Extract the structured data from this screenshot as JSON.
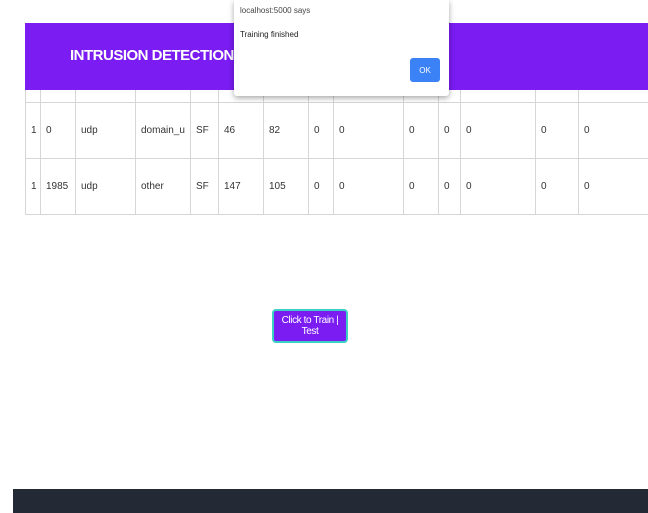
{
  "header": {
    "title": "INTRUSION DETECTION SYSTEM"
  },
  "table": {
    "rows": [
      [
        "1",
        "0",
        "udp",
        "domain_u",
        "SF",
        "46",
        "82",
        "0",
        "0",
        "0",
        "0",
        "0",
        "0",
        "0"
      ],
      [
        "1",
        "1985",
        "udp",
        "other",
        "SF",
        "147",
        "105",
        "0",
        "0",
        "0",
        "0",
        "0",
        "0",
        "0"
      ]
    ]
  },
  "actions": {
    "train_test_label": "Click to Train | Test"
  },
  "dialog": {
    "origin": "localhost:5000 says",
    "message": "Training finished",
    "ok_label": "OK"
  },
  "colors": {
    "header_bg": "#7a1cf2",
    "button_bg": "#7a1cf2",
    "button_border": "#3ad1c4",
    "ok_bg": "#3b82f6",
    "footer_bg": "#232a36"
  }
}
